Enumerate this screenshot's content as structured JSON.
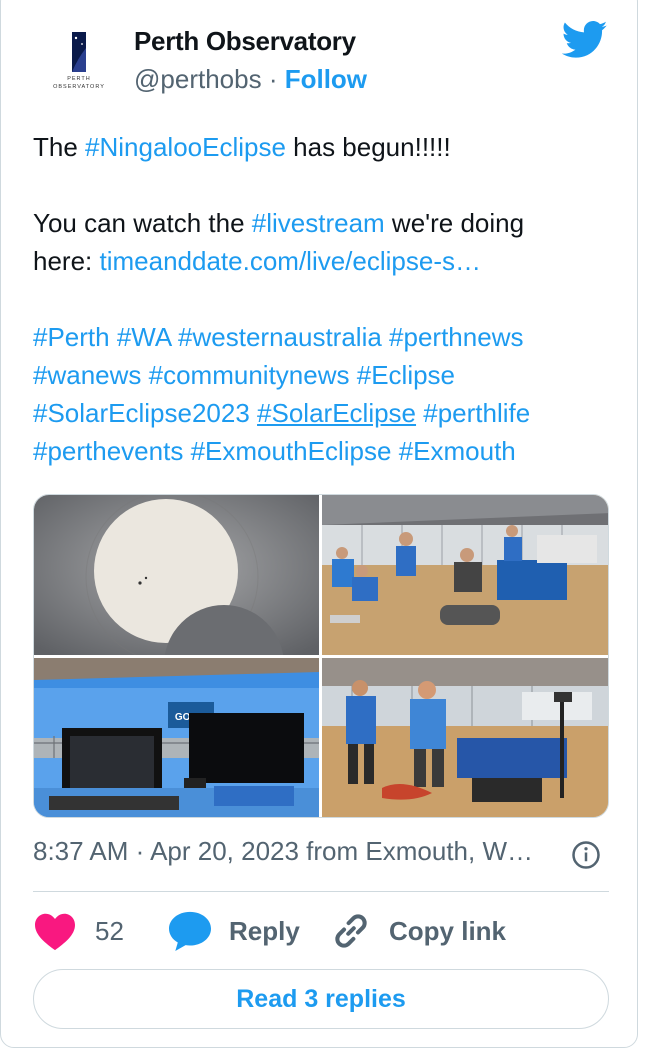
{
  "colors": {
    "accent": "#1d9bf0",
    "heart": "#f91880",
    "muted": "#536471",
    "border": "#cfd9de"
  },
  "author": {
    "name": "Perth Observatory",
    "handle": "@perthobs",
    "separator": "·",
    "follow_label": "Follow",
    "avatar_text_top": "PERTH",
    "avatar_text_bottom": "OBSERVATORY"
  },
  "brand_icon": "twitter-bird-icon",
  "tweet": {
    "l1_pre": "The ",
    "l1_tag": "#NingalooEclipse",
    "l1_post": " has begun!!!!!",
    "l2_pre": "You can watch the ",
    "l2_tag": "#livestream",
    "l2_post": " we're doing",
    "l3_pre": "here: ",
    "l3_link": "timeanddate.com/live/eclipse-s…",
    "tags": {
      "perth": "#Perth",
      "wa": "#WA",
      "westernaustralia": "#westernaustralia",
      "perthnews": "#perthnews",
      "wanews": "#wanews",
      "communitynews": "#communitynews",
      "eclipse": "#Eclipse",
      "solareclipse2023": "#SolarEclipse2023",
      "solareclipse": "#SolarEclipse",
      "perthlife": "#perthlife",
      "perthevents": "#perthevents",
      "exmoutheclipse": "#ExmouthEclipse",
      "exmouth": "#Exmouth"
    }
  },
  "photos": {
    "p3_sign": "GO BE"
  },
  "meta": {
    "timestamp": "8:37 AM · Apr 20, 2023 from Exmouth, W…",
    "info_icon": "info-icon"
  },
  "actions": {
    "like_count": "52",
    "reply_label": "Reply",
    "copy_label": "Copy link"
  },
  "read_replies_label": "Read 3 replies"
}
